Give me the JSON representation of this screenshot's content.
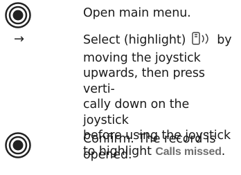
{
  "steps": [
    {
      "icon": "joystick-press-icon",
      "text": "Open main menu."
    },
    {
      "icon": "right-arrow-icon",
      "line1": "Select (highlight)",
      "inline_icon": "calls-list-icon",
      "line1_after": " by",
      "line2": "moving the joystick",
      "line3": "upwards, then press verti-",
      "line4": "cally down on the joystick",
      "line5": "before using the joystick",
      "line6_before": "to highlight ",
      "ui_name": "Calls missed",
      "line6_after": "."
    },
    {
      "icon": "joystick-press-icon",
      "line1": "Confirm. The record is",
      "line2": "opened."
    }
  ],
  "arrow_glyph": "→",
  "colors": {
    "ui_name": "#6e6e6e",
    "text": "#1a1a1a"
  }
}
